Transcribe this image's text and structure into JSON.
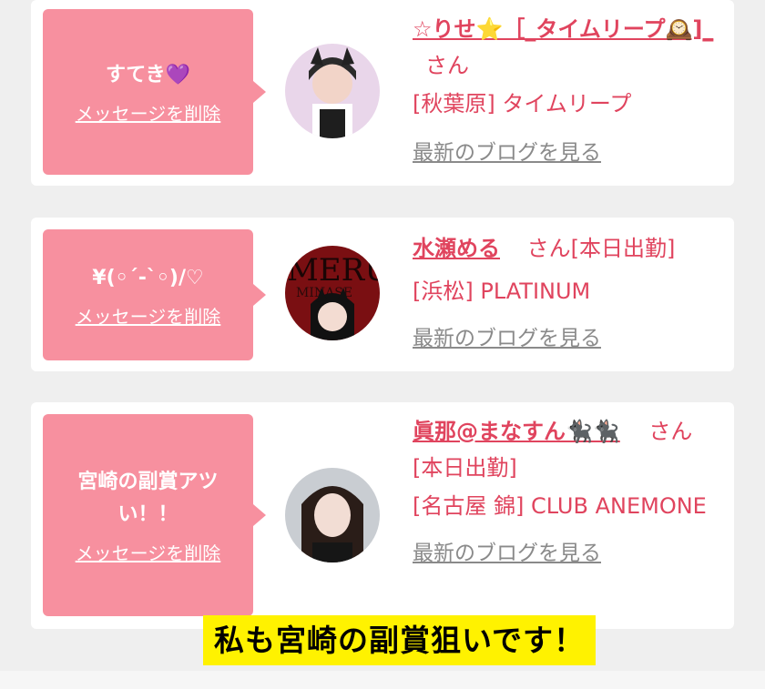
{
  "cards": [
    {
      "message": "すてき💜",
      "delete_label": "メッセージを削除",
      "name": "☆りせ⭐️［_タイムリープ🕰️]_",
      "san_label": "さん",
      "attendance": "",
      "shop": "[秋葉原] タイムリープ",
      "blog_label": "最新のブログを見る"
    },
    {
      "message": "¥(◦´-`◦)/♡",
      "delete_label": "メッセージを削除",
      "name": "水瀬める",
      "san_label": "さん",
      "attendance": "[本日出勤]",
      "shop": "[浜松] PLATINUM",
      "blog_label": "最新のブログを見る"
    },
    {
      "message": "宮崎の副賞アツい！！",
      "delete_label": "メッセージを削除",
      "name": "眞那@まなすん🐈‍⬛🐈‍⬛",
      "san_label": "さん",
      "attendance": "[本日出勤]",
      "shop": "[名古屋 錦] CLUB ANEMONE",
      "blog_label": "最新のブログを見る"
    }
  ],
  "caption": "私も宮崎の副賞狙いです！",
  "colors": {
    "bubble": "#f7909f",
    "accent": "#e0445e",
    "caption_bg": "#fff200"
  }
}
